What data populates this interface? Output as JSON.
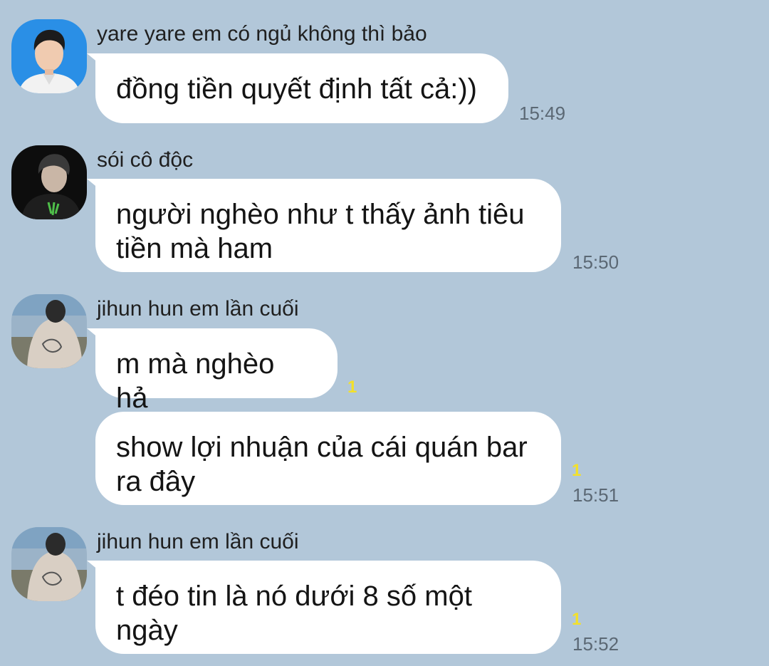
{
  "colors": {
    "background": "#b2c7d9",
    "bubble": "#ffffff",
    "unread": "#f3e02a",
    "time": "#5b6874"
  },
  "messages": [
    {
      "sender": "yare yare em có ngủ không thì bảo",
      "text": "đồng tiền quyết định tất cả:))",
      "time": "15:49",
      "unread": ""
    },
    {
      "sender": "sói cô độc",
      "text": "người nghèo như t thấy ảnh tiêu tiền mà ham",
      "time": "15:50",
      "unread": ""
    },
    {
      "sender": "jihun hun em lần cuối",
      "text": "m mà nghèo hả",
      "time": "",
      "unread": "1"
    },
    {
      "sender": "",
      "text": "show lợi nhuận của cái quán bar ra đây",
      "time": "15:51",
      "unread": "1"
    },
    {
      "sender": "jihun hun em lần cuối",
      "text": "t đéo tin là nó dưới 8 số một ngày",
      "time": "15:52",
      "unread": "1"
    }
  ]
}
